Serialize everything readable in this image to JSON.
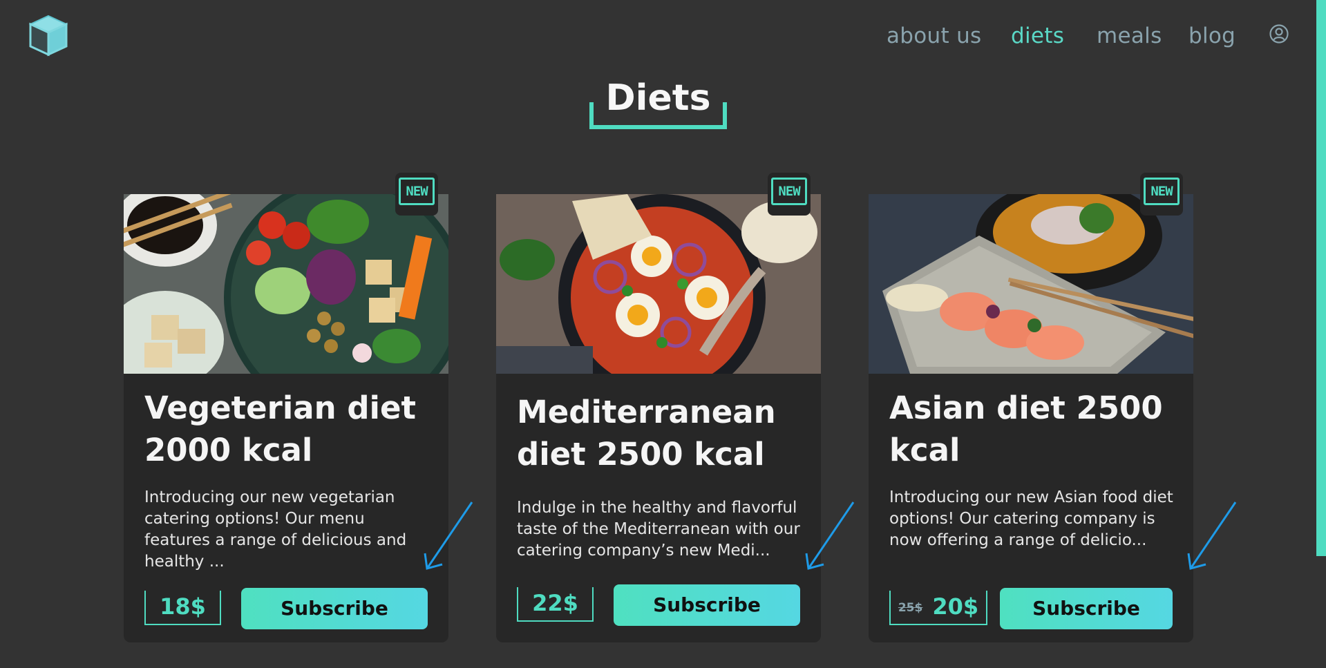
{
  "nav": {
    "items": [
      {
        "label": "about us",
        "active": false
      },
      {
        "label": "diets",
        "active": true
      },
      {
        "label": "meals",
        "active": false
      },
      {
        "label": "blog",
        "active": false
      }
    ]
  },
  "page": {
    "title": "Diets"
  },
  "badge": {
    "label": "NEW"
  },
  "cards": [
    {
      "title": "Vegeterian diet 2000 kcal",
      "description": "Introducing our new vegetarian catering options! Our menu features a range of delicious and healthy ...",
      "price": "18$",
      "old_price": "",
      "button": "Subscribe",
      "image": "vegetarian-bowl-photo"
    },
    {
      "title": "Mediterranean diet 2500 kcal",
      "description": "Indulge in the healthy and flavorful taste of the Mediterranean with our catering company’s new Medi...",
      "price": "22$",
      "old_price": "",
      "button": "Subscribe",
      "image": "shakshuka-pan-photo"
    },
    {
      "title": "Asian diet 2500 kcal",
      "description": "Introducing our new Asian food diet options! Our catering company is now offering a range of delicio...",
      "price": "20$",
      "old_price": "25$",
      "button": "Subscribe",
      "image": "salmon-sashimi-photo"
    }
  ],
  "colors": {
    "background": "#333333",
    "card": "#272727",
    "accent": "#4fdcc1",
    "nav_text": "#8aa3ad",
    "arrow": "#1e9be8"
  }
}
